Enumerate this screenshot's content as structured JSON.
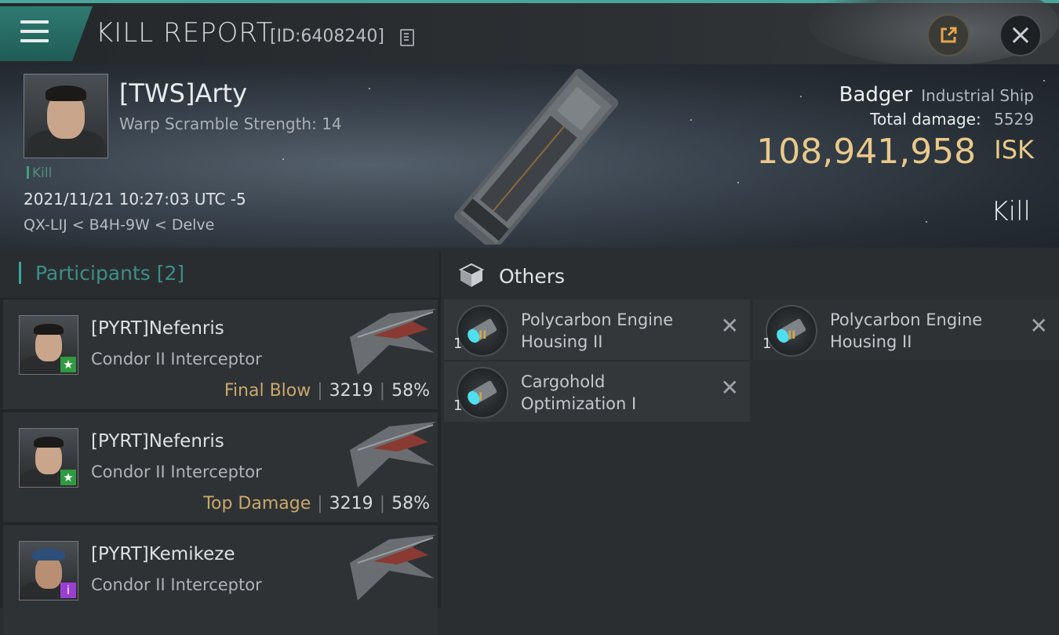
{
  "header": {
    "title": "KILL REPORT",
    "report_id": "[ID:6408240]",
    "menu_icon": "hamburger-icon",
    "copy_icon": "copy-icon",
    "share_icon": "share-icon",
    "close_icon": "close-icon"
  },
  "victim": {
    "name": "[TWS]Arty",
    "warp_scramble": "Warp Scramble Strength: 14",
    "tag": "Kill",
    "timestamp": "2021/11/21 10:27:03 UTC -5",
    "location": "QX-LIJ < B4H-9W < Delve"
  },
  "ship": {
    "name": "Badger",
    "class": "Industrial Ship",
    "total_damage_label": "Total damage:",
    "total_damage": "5529",
    "isk_value": "108,941,958",
    "isk_unit": "ISK",
    "result": "Kill"
  },
  "participants": {
    "title": "Participants",
    "count": "[2]",
    "rows": [
      {
        "name": "[PYRT]Nefenris",
        "ship": "Condor II Interceptor",
        "label": "Final Blow",
        "damage": "3219",
        "percent": "58%",
        "badge": "★",
        "sep1": "|",
        "sep2": "|"
      },
      {
        "name": "[PYRT]Nefenris",
        "ship": "Condor II Interceptor",
        "label": "Top Damage",
        "damage": "3219",
        "percent": "58%",
        "badge": "★",
        "sep1": "|",
        "sep2": "|"
      },
      {
        "name": "[PYRT]Kemikeze",
        "ship": "Condor II Interceptor",
        "label": "",
        "damage": "",
        "percent": "",
        "badge": "i",
        "sep1": "",
        "sep2": ""
      }
    ]
  },
  "others": {
    "title": "Others",
    "items": [
      {
        "name": "Polycarbon Engine Housing II",
        "qty": "1",
        "tier": "II"
      },
      {
        "name": "Polycarbon Engine Housing II",
        "qty": "1",
        "tier": "II"
      },
      {
        "name": "Cargohold Optimization I",
        "qty": "1",
        "tier": "I"
      }
    ],
    "remove_glyph": "✕"
  },
  "colors": {
    "accent": "#3aa99c",
    "isk": "#e9c98a",
    "final_blow": "#c8a96b",
    "badge_green": "#2f9a41",
    "badge_purple": "#9b3fd3"
  }
}
